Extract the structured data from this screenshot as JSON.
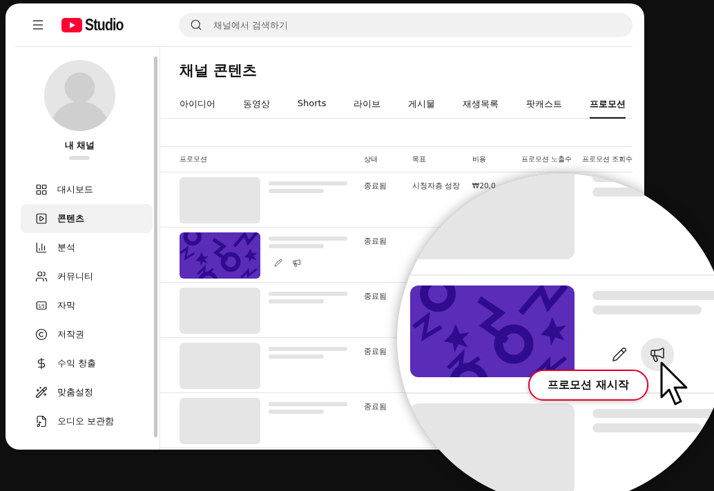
{
  "header": {
    "logo_text": "Studio",
    "search": {
      "placeholder": "채널에서 검색하기"
    }
  },
  "sidebar": {
    "channel_name": "내 채널",
    "items": [
      {
        "label": "대시보드",
        "selected": false
      },
      {
        "label": "콘텐츠",
        "selected": true
      },
      {
        "label": "분석",
        "selected": false
      },
      {
        "label": "커뮤니티",
        "selected": false
      },
      {
        "label": "자막",
        "selected": false
      },
      {
        "label": "저작권",
        "selected": false
      },
      {
        "label": "수익 창출",
        "selected": false
      },
      {
        "label": "맞춤설정",
        "selected": false
      },
      {
        "label": "오디오 보관함",
        "selected": false
      }
    ]
  },
  "page": {
    "title": "채널 콘텐츠",
    "tabs": [
      {
        "label": "아이디어",
        "selected": false
      },
      {
        "label": "동영상",
        "selected": false
      },
      {
        "label": "Shorts",
        "selected": false
      },
      {
        "label": "라이브",
        "selected": false
      },
      {
        "label": "게시물",
        "selected": false
      },
      {
        "label": "재생목록",
        "selected": false
      },
      {
        "label": "팟캐스트",
        "selected": false
      },
      {
        "label": "프로모션",
        "selected": true
      }
    ]
  },
  "table": {
    "columns": [
      "프로모션",
      "상태",
      "목표",
      "비용",
      "프로모션 노출수",
      "프로모션 조회수"
    ],
    "rows": [
      {
        "kind": "placeholder",
        "status": "종료됨",
        "goal": "시청자층 성장",
        "cost": "₩20,0",
        "show_actions": false
      },
      {
        "kind": "picture",
        "status": "종료됨",
        "show_actions": true
      },
      {
        "kind": "placeholder",
        "status": "종료됨",
        "show_actions": false
      },
      {
        "kind": "placeholder",
        "status": "종료됨",
        "show_actions": false
      },
      {
        "kind": "placeholder",
        "status": "종료됨",
        "show_actions": false
      }
    ]
  },
  "magnifier": {
    "rows": [
      {
        "kind": "placeholder"
      },
      {
        "kind": "picture",
        "tooltip": "프로모션 재시작"
      },
      {
        "kind": "placeholder"
      }
    ]
  }
}
